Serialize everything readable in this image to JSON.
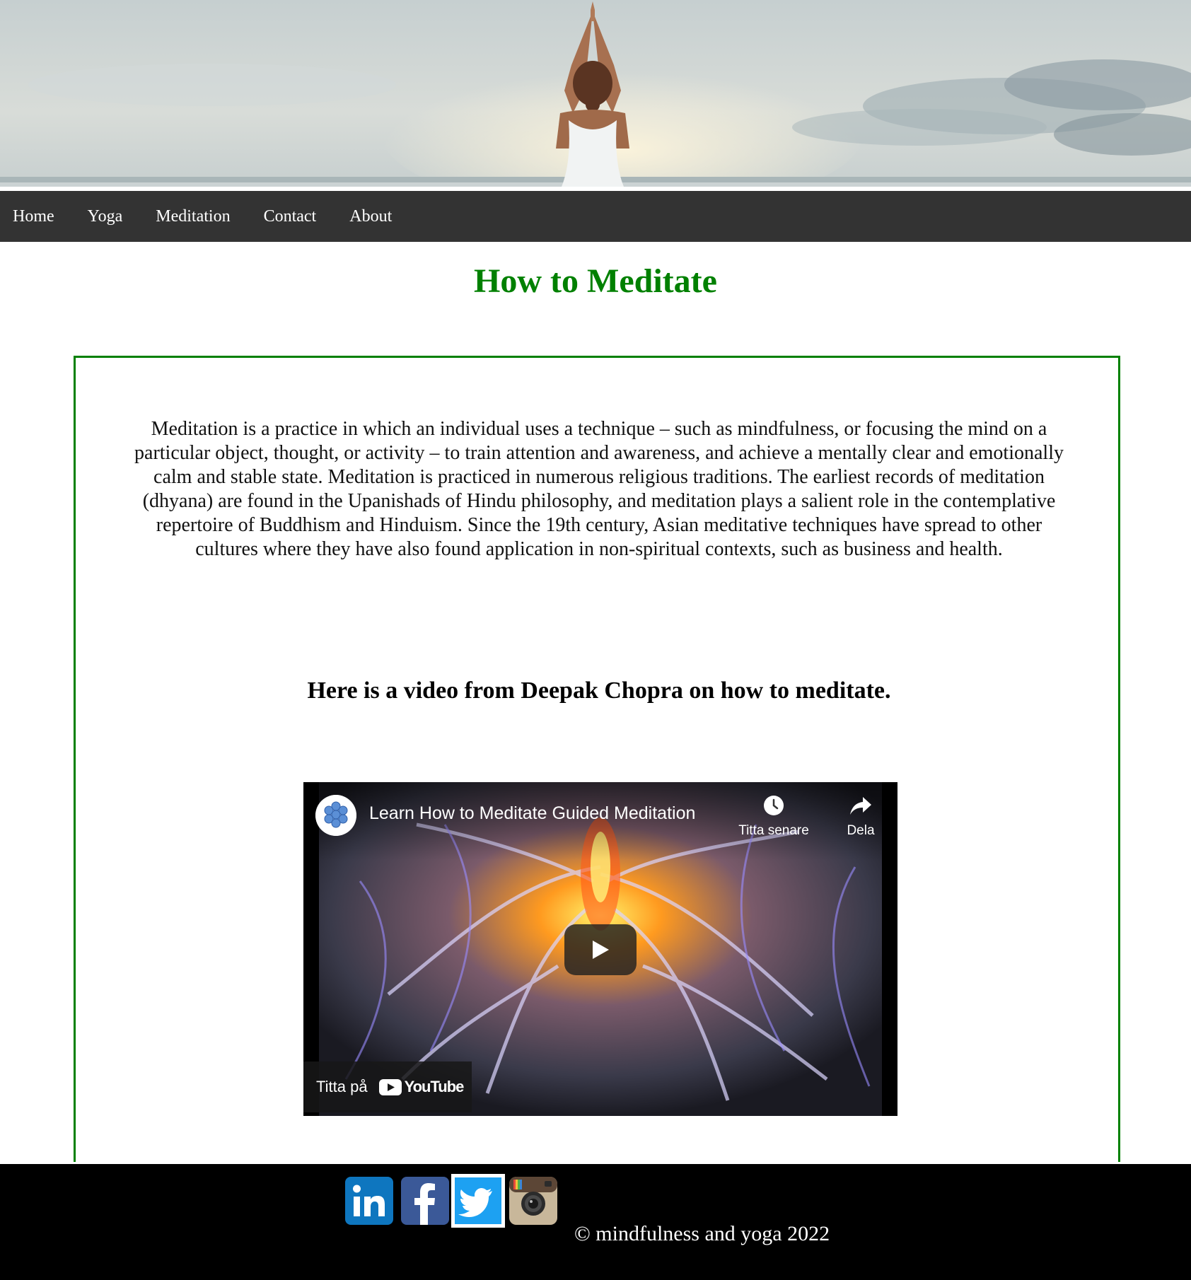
{
  "nav": {
    "items": [
      {
        "label": "Home"
      },
      {
        "label": "Yoga"
      },
      {
        "label": "Meditation"
      },
      {
        "label": "Contact"
      },
      {
        "label": "About"
      }
    ]
  },
  "main": {
    "title": "How to Meditate",
    "intro": "Meditation is a practice in which an individual uses a technique – such as mindfulness, or focusing the mind on a particular object, thought, or activity – to train attention and awareness, and achieve a mentally clear and emotionally calm and stable state. Meditation is practiced in numerous religious traditions. The earliest records of meditation (dhyana) are found in the Upanishads of Hindu philosophy, and meditation plays a salient role in the contemplative repertoire of Buddhism and Hinduism. Since the 19th century, Asian meditative techniques have spread to other cultures where they have also found application in non-spiritual contexts, such as business and health.",
    "video_heading": "Here is a video from Deepak Chopra on how to meditate."
  },
  "video": {
    "title": "Learn How to Meditate Guided Meditation",
    "watch_later_label": "Titta senare",
    "share_label": "Dela",
    "watch_on_label": "Titta på",
    "youtube_wordmark": "YouTube"
  },
  "footer": {
    "social_icons": [
      "linkedin-icon",
      "facebook-icon",
      "twitter-icon",
      "instagram-icon"
    ],
    "copyright": "© mindfulness and yoga 2022"
  },
  "colors": {
    "accent_green": "#008000",
    "nav_background": "#333333",
    "footer_background": "#000000"
  }
}
